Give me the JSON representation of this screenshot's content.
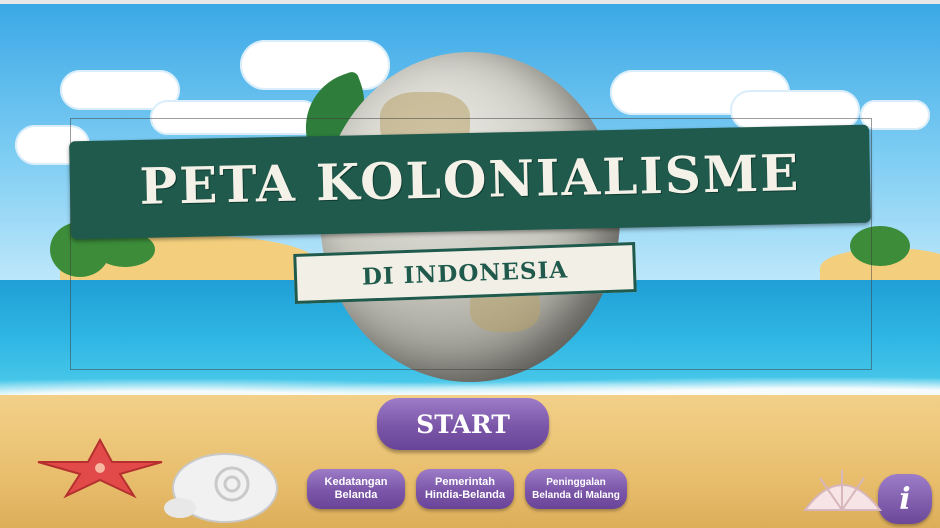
{
  "title": {
    "main": "PETA KOLONIALISME",
    "sub": "DI INDONESIA"
  },
  "buttons": {
    "start": "START",
    "menu": [
      {
        "label": "Kedatangan\nBelanda"
      },
      {
        "label": "Pemerintah\nHindia-Belanda"
      },
      {
        "label": "Peninggalan\nBelanda di Malang"
      }
    ],
    "info": "i"
  },
  "icons": [
    "globe-icon",
    "starfish-icon",
    "seashell-icon",
    "info-icon"
  ],
  "colors": {
    "banner": "#1f5a4c",
    "button": "#7b56a8",
    "sky": "#3aa7e6",
    "sea": "#2fb6e4",
    "sand": "#e9bf6e"
  }
}
